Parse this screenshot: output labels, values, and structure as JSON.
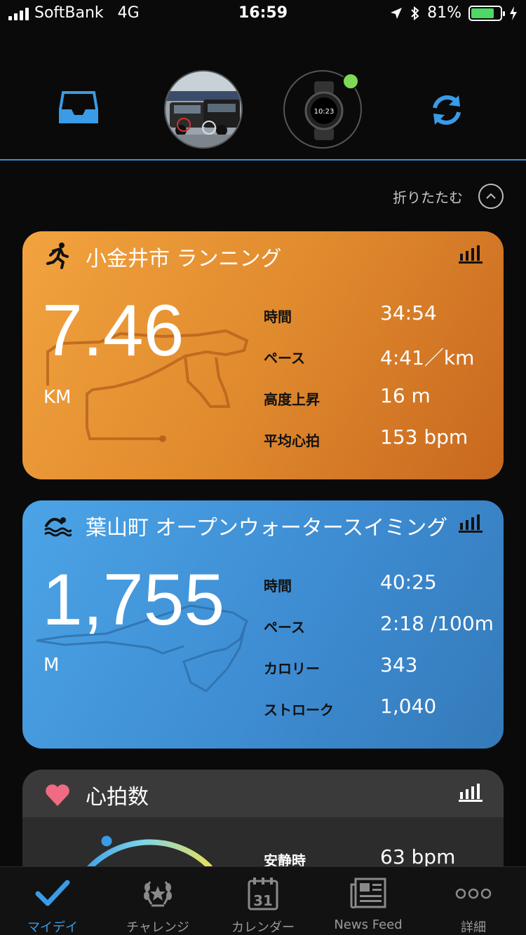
{
  "status_bar": {
    "carrier": "SoftBank",
    "network": "4G",
    "time": "16:59",
    "battery_percent": "81%",
    "battery_level": 0.81
  },
  "header": {
    "inbox_icon": "inbox-icon",
    "sync_icon": "sync-icon",
    "device_status_color": "#7ed957"
  },
  "collapse": {
    "label": "折りたたむ"
  },
  "cards": {
    "running": {
      "title": "小金井市 ランニング",
      "distance": "7.46",
      "unit": "KM",
      "stats": [
        {
          "label": "時間",
          "value": "34:54"
        },
        {
          "label": "ペース",
          "value": "4:41／km"
        },
        {
          "label": "高度上昇",
          "value": "16 m"
        },
        {
          "label": "平均心拍",
          "value": "153 bpm"
        }
      ]
    },
    "swimming": {
      "title": "葉山町 オープンウォータースイミング",
      "distance": "1,755",
      "unit": "M",
      "stats": [
        {
          "label": "時間",
          "value": "40:25"
        },
        {
          "label": "ペース",
          "value": "2:18 /100m"
        },
        {
          "label": "カロリー",
          "value": "343"
        },
        {
          "label": "ストローク",
          "value": "1,040"
        }
      ]
    },
    "heart_rate": {
      "title": "心拍数",
      "stats": [
        {
          "label": "安静時",
          "value": "63 bpm"
        }
      ]
    }
  },
  "tab_bar": {
    "active_color": "#3a9be6",
    "items": [
      {
        "label": "マイデイ",
        "icon": "checkmark-icon"
      },
      {
        "label": "チャレンジ",
        "icon": "laurel-icon"
      },
      {
        "label": "カレンダー",
        "icon": "calendar-icon",
        "calendar_day": "31"
      },
      {
        "label": "News Feed",
        "icon": "newspaper-icon"
      },
      {
        "label": "詳細",
        "icon": "more-dots-icon"
      }
    ]
  }
}
